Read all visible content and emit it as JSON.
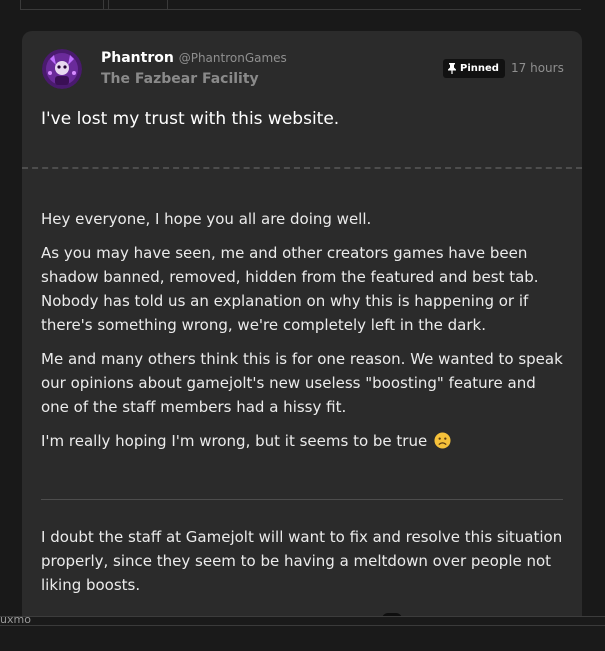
{
  "post": {
    "author_name": "Phantron",
    "author_handle": "@PhantronGames",
    "community": "The Fazbear Facility",
    "pinned_label": "Pinned",
    "timestamp": "17 hours",
    "title": "I've lost my trust with this website.",
    "paragraphs": [
      "Hey everyone, I hope you all are doing well.",
      "As you may have seen, me and other creators games have been shadow banned, removed, hidden from the featured and best tab. Nobody has told us an explanation on why this is happening or if there's something wrong, we're completely left in the dark.",
      "Me and many others think this is for one reason. We wanted to speak our opinions about gamejolt's new useless \"boosting\" feature and one of the staff members had a hissy fit.",
      "I'm really hoping I'm wrong, but it seems to be true"
    ],
    "followup": "I doubt the staff at Gamejolt will want to fix and resolve this situation properly, since they seem to be having a meltdown over people not liking boosts."
  },
  "overlay": {
    "text": "uxmo"
  },
  "icons": {
    "avatar": "avatar-image",
    "pin": "pin-icon",
    "emoji": "frowning-face-emoji"
  },
  "colors": {
    "background": "#191919",
    "card": "#2b2b2b",
    "text": "#ebebeb",
    "muted": "#8f8f8f",
    "badge": "#111111"
  }
}
